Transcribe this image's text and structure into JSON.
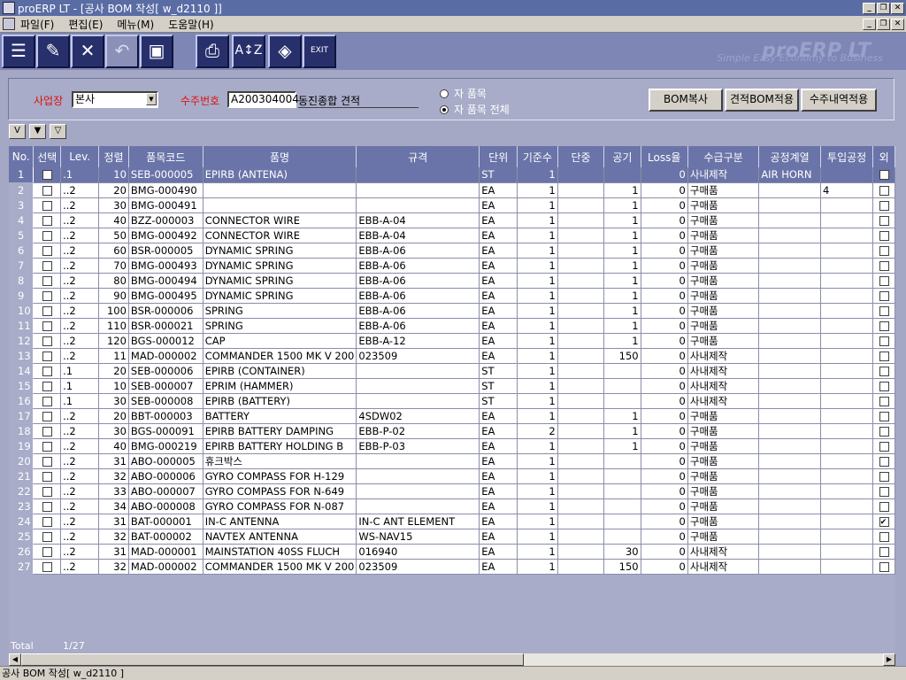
{
  "window": {
    "title": "proERP LT - [공사 BOM 작성[ w_d2110 ]]"
  },
  "menu": [
    "파일(F)",
    "편집(E)",
    "메뉴(M)",
    "도움말(H)"
  ],
  "toolbar": {
    "brand": "proERP LT",
    "tagline": "Simple Easy Economy to Business",
    "exit_label": "EXIT"
  },
  "filters": {
    "business_label": "사업장",
    "business_value": "본사",
    "order_label": "수주번호",
    "order_no": "A200304004",
    "order_name": "동진종합 견적",
    "radio_options": [
      {
        "label": "자 품목",
        "checked": false
      },
      {
        "label": "자 품목 전체",
        "checked": true
      }
    ],
    "buttons": [
      "BOM복사",
      "견적BOM적용",
      "수주내역적용"
    ]
  },
  "small_buttons": [
    "V",
    "▼",
    "▽"
  ],
  "table": {
    "columns": [
      "No.",
      "선택",
      "Lev.",
      "정렬",
      "품목코드",
      "품명",
      "규격",
      "단위",
      "기준수",
      "단중",
      "공기",
      "Loss율",
      "수급구분",
      "공정계열",
      "투입공정",
      "외"
    ],
    "rows": [
      {
        "no": "1",
        "lev": ".1",
        "sort": "10",
        "code": "SEB-000005",
        "name": "EPIRB (ANTENA)",
        "spec": "",
        "unit": "ST",
        "base": "1",
        "weight": "",
        "air": "",
        "loss": "0",
        "supply": "사내제작",
        "proc": "AIR HORN",
        "input": "",
        "ext": true
      },
      {
        "no": "2",
        "lev": "..2",
        "sort": "20",
        "code": "BMG-000490",
        "name": "",
        "spec": "",
        "unit": "EA",
        "base": "1",
        "weight": "",
        "air": "1",
        "loss": "0",
        "supply": "구매품",
        "proc": "",
        "input": "4",
        "ext": false
      },
      {
        "no": "3",
        "lev": "..2",
        "sort": "30",
        "code": "BMG-000491",
        "name": "",
        "spec": "",
        "unit": "EA",
        "base": "1",
        "weight": "",
        "air": "1",
        "loss": "0",
        "supply": "구매품",
        "proc": "",
        "input": "",
        "ext": false
      },
      {
        "no": "4",
        "lev": "..2",
        "sort": "40",
        "code": "BZZ-000003",
        "name": "CONNECTOR WIRE",
        "spec": "EBB-A-04",
        "unit": "EA",
        "base": "1",
        "weight": "",
        "air": "1",
        "loss": "0",
        "supply": "구매품",
        "proc": "",
        "input": "",
        "ext": false
      },
      {
        "no": "5",
        "lev": "..2",
        "sort": "50",
        "code": "BMG-000492",
        "name": "CONNECTOR WIRE",
        "spec": "EBB-A-04",
        "unit": "EA",
        "base": "1",
        "weight": "",
        "air": "1",
        "loss": "0",
        "supply": "구매품",
        "proc": "",
        "input": "",
        "ext": false
      },
      {
        "no": "6",
        "lev": "..2",
        "sort": "60",
        "code": "BSR-000005",
        "name": "DYNAMIC SPRING",
        "spec": "EBB-A-06",
        "unit": "EA",
        "base": "1",
        "weight": "",
        "air": "1",
        "loss": "0",
        "supply": "구매품",
        "proc": "",
        "input": "",
        "ext": false
      },
      {
        "no": "7",
        "lev": "..2",
        "sort": "70",
        "code": "BMG-000493",
        "name": "DYNAMIC SPRING",
        "spec": "EBB-A-06",
        "unit": "EA",
        "base": "1",
        "weight": "",
        "air": "1",
        "loss": "0",
        "supply": "구매품",
        "proc": "",
        "input": "",
        "ext": false
      },
      {
        "no": "8",
        "lev": "..2",
        "sort": "80",
        "code": "BMG-000494",
        "name": "DYNAMIC SPRING",
        "spec": "EBB-A-06",
        "unit": "EA",
        "base": "1",
        "weight": "",
        "air": "1",
        "loss": "0",
        "supply": "구매품",
        "proc": "",
        "input": "",
        "ext": false
      },
      {
        "no": "9",
        "lev": "..2",
        "sort": "90",
        "code": "BMG-000495",
        "name": "DYNAMIC SPRING",
        "spec": "EBB-A-06",
        "unit": "EA",
        "base": "1",
        "weight": "",
        "air": "1",
        "loss": "0",
        "supply": "구매품",
        "proc": "",
        "input": "",
        "ext": false
      },
      {
        "no": "10",
        "lev": "..2",
        "sort": "100",
        "code": "BSR-000006",
        "name": "SPRING",
        "spec": "EBB-A-06",
        "unit": "EA",
        "base": "1",
        "weight": "",
        "air": "1",
        "loss": "0",
        "supply": "구매품",
        "proc": "",
        "input": "",
        "ext": false
      },
      {
        "no": "11",
        "lev": "..2",
        "sort": "110",
        "code": "BSR-000021",
        "name": "SPRING",
        "spec": "EBB-A-06",
        "unit": "EA",
        "base": "1",
        "weight": "",
        "air": "1",
        "loss": "0",
        "supply": "구매품",
        "proc": "",
        "input": "",
        "ext": false
      },
      {
        "no": "12",
        "lev": "..2",
        "sort": "120",
        "code": "BGS-000012",
        "name": "CAP",
        "spec": "EBB-A-12",
        "unit": "EA",
        "base": "1",
        "weight": "",
        "air": "1",
        "loss": "0",
        "supply": "구매품",
        "proc": "",
        "input": "",
        "ext": false
      },
      {
        "no": "13",
        "lev": "..2",
        "sort": "11",
        "code": "MAD-000002",
        "name": "COMMANDER 1500 MK V 200",
        "spec": "023509",
        "unit": "EA",
        "base": "1",
        "weight": "",
        "air": "150",
        "loss": "0",
        "supply": "사내제작",
        "proc": "",
        "input": "",
        "ext": false
      },
      {
        "no": "14",
        "lev": ".1",
        "sort": "20",
        "code": "SEB-000006",
        "name": "EPIRB (CONTAINER)",
        "spec": "",
        "unit": "ST",
        "base": "1",
        "weight": "",
        "air": "",
        "loss": "0",
        "supply": "사내제작",
        "proc": "",
        "input": "",
        "ext": false
      },
      {
        "no": "15",
        "lev": ".1",
        "sort": "10",
        "code": "SEB-000007",
        "name": "EPRIM (HAMMER)",
        "spec": "",
        "unit": "ST",
        "base": "1",
        "weight": "",
        "air": "",
        "loss": "0",
        "supply": "사내제작",
        "proc": "",
        "input": "",
        "ext": false
      },
      {
        "no": "16",
        "lev": ".1",
        "sort": "30",
        "code": "SEB-000008",
        "name": "EPIRB (BATTERY)",
        "spec": "",
        "unit": "ST",
        "base": "1",
        "weight": "",
        "air": "",
        "loss": "0",
        "supply": "사내제작",
        "proc": "",
        "input": "",
        "ext": false
      },
      {
        "no": "17",
        "lev": "..2",
        "sort": "20",
        "code": "BBT-000003",
        "name": "BATTERY",
        "spec": "4SDW02",
        "unit": "EA",
        "base": "1",
        "weight": "",
        "air": "1",
        "loss": "0",
        "supply": "구매품",
        "proc": "",
        "input": "",
        "ext": false
      },
      {
        "no": "18",
        "lev": "..2",
        "sort": "30",
        "code": "BGS-000091",
        "name": "EPIRB BATTERY DAMPING",
        "spec": "EBB-P-02",
        "unit": "EA",
        "base": "2",
        "weight": "",
        "air": "1",
        "loss": "0",
        "supply": "구매품",
        "proc": "",
        "input": "",
        "ext": false
      },
      {
        "no": "19",
        "lev": "..2",
        "sort": "40",
        "code": "BMG-000219",
        "name": "EPIRB BATTERY HOLDING B",
        "spec": "EBB-P-03",
        "unit": "EA",
        "base": "1",
        "weight": "",
        "air": "1",
        "loss": "0",
        "supply": "구매품",
        "proc": "",
        "input": "",
        "ext": false
      },
      {
        "no": "20",
        "lev": "..2",
        "sort": "31",
        "code": "ABO-000005",
        "name": "휴크박스",
        "spec": "",
        "unit": "EA",
        "base": "1",
        "weight": "",
        "air": "",
        "loss": "0",
        "supply": "구매품",
        "proc": "",
        "input": "",
        "ext": false
      },
      {
        "no": "21",
        "lev": "..2",
        "sort": "32",
        "code": "ABO-000006",
        "name": "GYRO COMPASS FOR H-129",
        "spec": "",
        "unit": "EA",
        "base": "1",
        "weight": "",
        "air": "",
        "loss": "0",
        "supply": "구매품",
        "proc": "",
        "input": "",
        "ext": false
      },
      {
        "no": "22",
        "lev": "..2",
        "sort": "33",
        "code": "ABO-000007",
        "name": "GYRO COMPASS FOR N-649",
        "spec": "",
        "unit": "EA",
        "base": "1",
        "weight": "",
        "air": "",
        "loss": "0",
        "supply": "구매품",
        "proc": "",
        "input": "",
        "ext": false
      },
      {
        "no": "23",
        "lev": "..2",
        "sort": "34",
        "code": "ABO-000008",
        "name": "GYRO COMPASS FOR N-087",
        "spec": "",
        "unit": "EA",
        "base": "1",
        "weight": "",
        "air": "",
        "loss": "0",
        "supply": "구매품",
        "proc": "",
        "input": "",
        "ext": false
      },
      {
        "no": "24",
        "lev": "..2",
        "sort": "31",
        "code": "BAT-000001",
        "name": "IN-C ANTENNA",
        "spec": "IN-C ANT ELEMENT",
        "unit": "EA",
        "base": "1",
        "weight": "",
        "air": "",
        "loss": "0",
        "supply": "구매품",
        "proc": "",
        "input": "",
        "ext": true
      },
      {
        "no": "25",
        "lev": "..2",
        "sort": "32",
        "code": "BAT-000002",
        "name": "NAVTEX ANTENNA",
        "spec": "WS-NAV15",
        "unit": "EA",
        "base": "1",
        "weight": "",
        "air": "",
        "loss": "0",
        "supply": "구매품",
        "proc": "",
        "input": "",
        "ext": false
      },
      {
        "no": "26",
        "lev": "..2",
        "sort": "31",
        "code": "MAD-000001",
        "name": "MAINSTATION 40SS FLUCH",
        "spec": "016940",
        "unit": "EA",
        "base": "1",
        "weight": "",
        "air": "30",
        "loss": "0",
        "supply": "사내제작",
        "proc": "",
        "input": "",
        "ext": false
      },
      {
        "no": "27",
        "lev": "..2",
        "sort": "32",
        "code": "MAD-000002",
        "name": "COMMANDER 1500 MK V 200",
        "spec": "023509",
        "unit": "EA",
        "base": "1",
        "weight": "",
        "air": "150",
        "loss": "0",
        "supply": "사내제작",
        "proc": "",
        "input": "",
        "ext": false
      }
    ]
  },
  "footer": {
    "total_label": "Total",
    "total_value": "1/27"
  },
  "statusbar": {
    "text": "공사 BOM 작성[ w_d2110 ]"
  }
}
